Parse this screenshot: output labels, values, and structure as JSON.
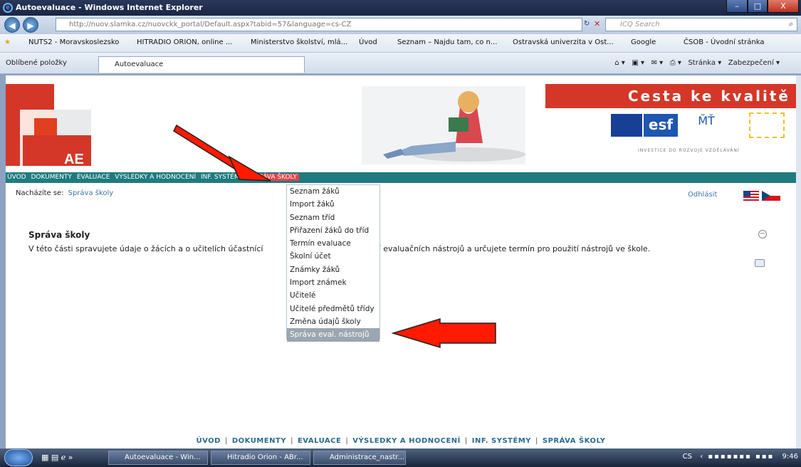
{
  "window": {
    "title": "Autoevaluace - Windows Internet Explorer",
    "minimize": "–",
    "maximize": "□",
    "close": "X"
  },
  "addressbar": {
    "url": "http://nuov.slamka.cz/nuovckk_portal/Default.aspx?tabid=57&language=cs-CZ",
    "search_placeholder": "ICQ Search"
  },
  "favorites_bar": [
    "NUTS2 - Moravskoslezsko",
    "HITRADIO ORION, online ...",
    "Ministerstvo školství, mlá...",
    "Úvod",
    "Seznam – Najdu tam, co n...",
    "Ostravská univerzita v Ost...",
    "Google",
    "ČSOB - Úvodní stránka"
  ],
  "tabs": {
    "favorites_label": "Oblíbené položky",
    "active_tab": "Autoevaluace",
    "page_menu": "Stránka ▾",
    "security_menu": "Zabezpečení ▾"
  },
  "site": {
    "logo_text": "AE",
    "brand_title": "Cesta ke kvalitě",
    "brand_subtitle": "INVESTICE DO ROZVOJE VZDĚLÁVÁNÍ",
    "nav": [
      "ÚVOD",
      "DOKUMENTY",
      "EVALUACE",
      "VÝSLEDKY A HODNOCENÍ",
      "INF. SYSTÉMY",
      "SPRÁVA ŠKOLY"
    ],
    "breadcrumb_label": "Nacházíte se:",
    "breadcrumb_value": "Správa školy",
    "logout": "Odhlásit",
    "section_title": "Správa školy",
    "section_text_start": "V této části spravujete údaje o žácích a o učitelích účastnící",
    "section_text_end": "omocí evaluačních nástrojů a určujete termín pro použití nástrojů ve škole.",
    "menu": [
      "Seznam žáků",
      "Import žáků",
      "Seznam tříd",
      "Přiřazení žáků do tříd",
      "Termín evaluace",
      "Školní účet",
      "Známky žáků",
      "Import známek",
      "Učitelé",
      "Učitelé předmětů třídy",
      "Změna údajů školy",
      "Správa eval. nástrojů"
    ],
    "footer": [
      "ÚVOD",
      "DOKUMENTY",
      "EVALUACE",
      "VÝSLEDKY A HODNOCENÍ",
      "INF. SYSTÉMY",
      "SPRÁVA ŠKOLY"
    ]
  },
  "taskbar": {
    "items": [
      "Autoevaluace - Win...",
      "Hitradio Orion - ABr...",
      "Administrace_nastr..."
    ],
    "lang": "CS",
    "time": "9:46"
  },
  "colors": {
    "accent_red": "#d43727",
    "nav_teal": "#1f7b7f",
    "nav_active": "#e7424b",
    "link_blue": "#3978a8"
  }
}
